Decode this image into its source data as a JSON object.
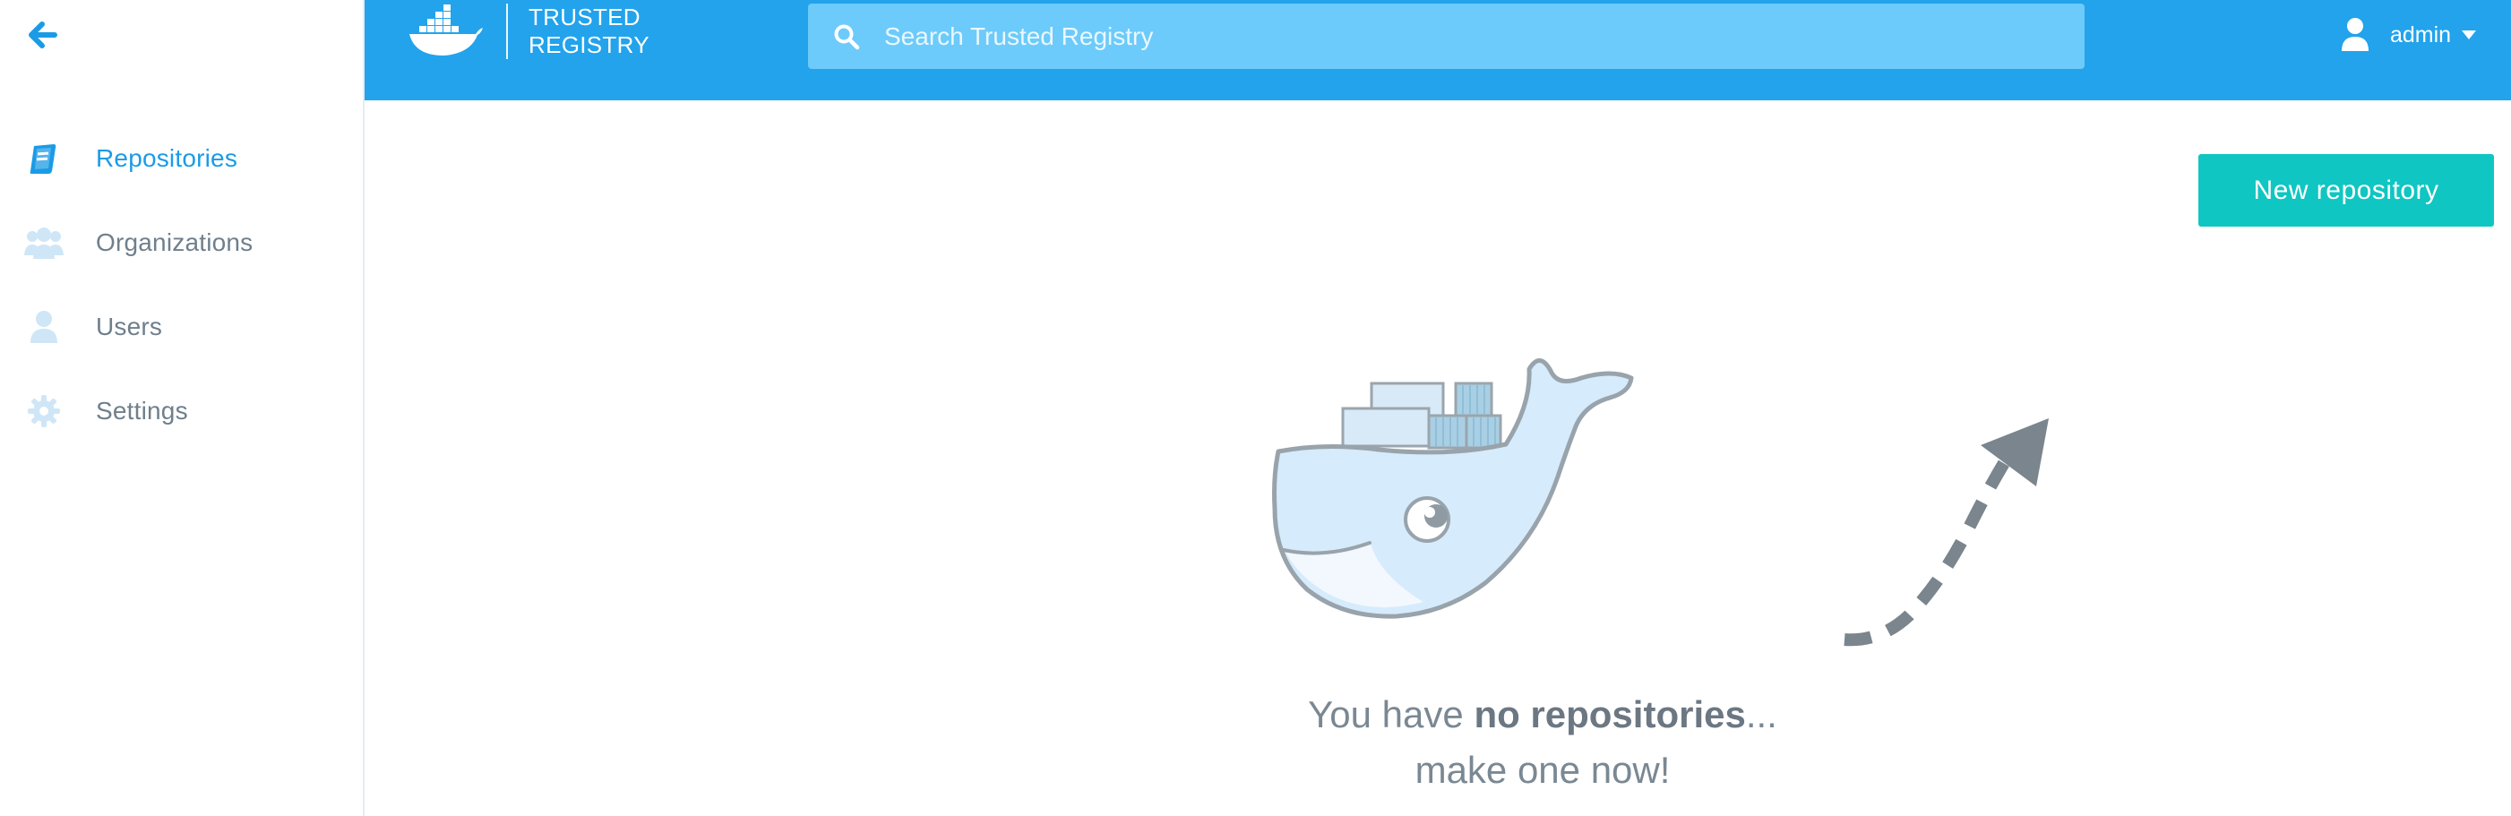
{
  "app": {
    "logo_line1": "TRUSTED",
    "logo_line2": "REGISTRY"
  },
  "colors": {
    "header_bg": "#22a3ec",
    "search_bg": "#6ccbfa",
    "accent_active": "#1b9be6",
    "primary_button": "#0fc6c2",
    "nav_icon_inactive": "#cfe6f7"
  },
  "sidebar": {
    "back_icon": "back-arrow-icon",
    "items": [
      {
        "label": "Repositories",
        "icon": "book-icon",
        "active": true
      },
      {
        "label": "Organizations",
        "icon": "group-icon",
        "active": false
      },
      {
        "label": "Users",
        "icon": "user-icon",
        "active": false
      },
      {
        "label": "Settings",
        "icon": "gear-icon",
        "active": false
      }
    ]
  },
  "header": {
    "search": {
      "placeholder": "Search Trusted Registry",
      "value": ""
    },
    "user": {
      "name": "admin"
    }
  },
  "main": {
    "new_repo_label": "New repository",
    "empty_state": {
      "prefix": "You have ",
      "emphasis": "no repositories",
      "suffix": "...",
      "line2": "make one now!"
    }
  }
}
